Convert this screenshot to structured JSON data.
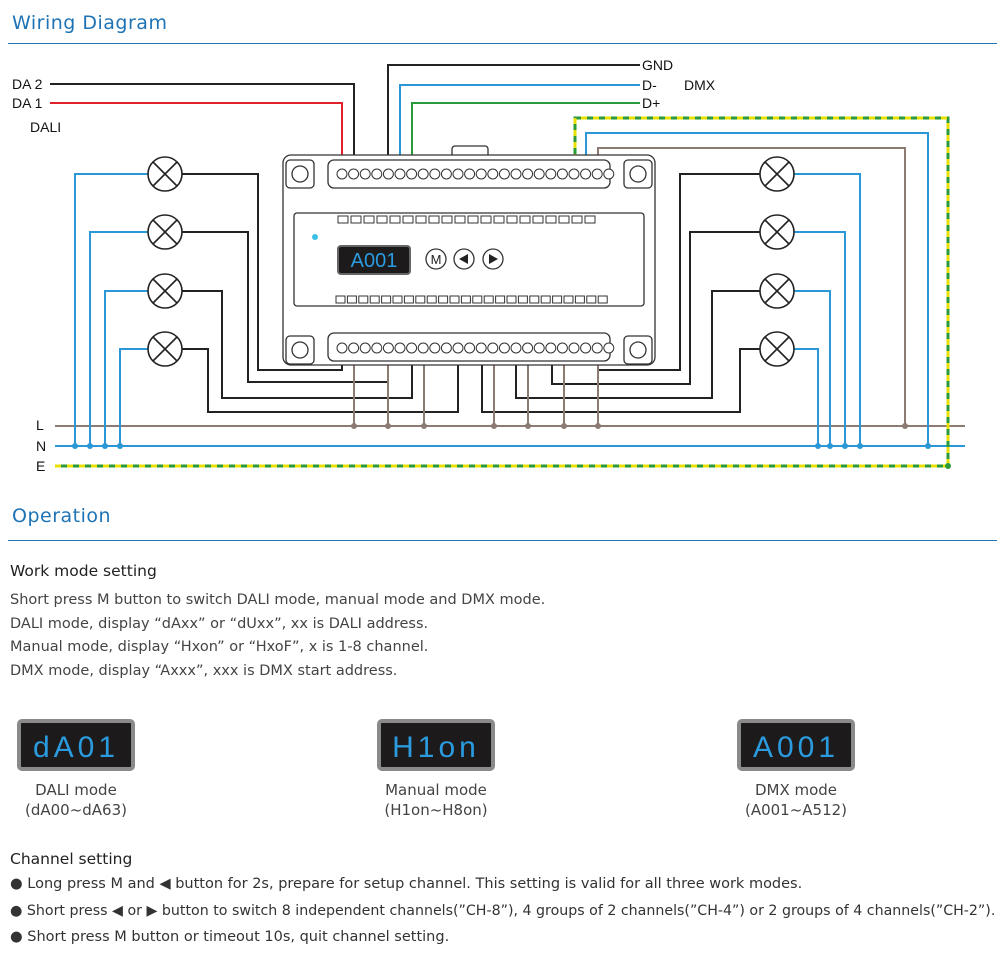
{
  "wiring": {
    "title": "Wiring Diagram",
    "labels": {
      "da2": "DA 2",
      "da1": "DA 1",
      "dali": "DALI",
      "gnd": "GND",
      "dminus": "D-",
      "dplus": "D+",
      "dmx": "DMX",
      "l": "L",
      "n": "N",
      "e": "E"
    },
    "device_display": "A001",
    "btn_m": "M",
    "colors": {
      "line_l": "#8c7b72",
      "line_n": "#2a98d6",
      "earth": "#d8d000",
      "earth2": "#2a9a3a",
      "dali_red": "#e0202a",
      "dplus": "#2a9a3a"
    }
  },
  "operation": {
    "title": "Operation",
    "work_mode": {
      "heading": "Work mode setting",
      "lines": [
        "Short press M button to switch DALI mode, manual mode and DMX mode.",
        "DALI mode, display “dAxx” or “dUxx”, xx is DALI address.",
        "Manual mode, display “Hxon” or “HxoF”, x is 1-8 channel.",
        "DMX mode, display “Axxx”, xxx is DMX start address."
      ]
    },
    "modes": [
      {
        "display": "dA01",
        "name": "DALI mode",
        "range": "(dA00~dA63)"
      },
      {
        "display": "H1on",
        "name": "Manual mode",
        "range": "(H1on~H8on)"
      },
      {
        "display": "A001",
        "name": "DMX mode",
        "range": "(A001~A512)"
      }
    ],
    "channel": {
      "heading": "Channel setting",
      "bullets": [
        "● Long press M and ◀ button for 2s, prepare for setup channel. This setting is valid for all three work modes.",
        "● Short press ◀ or ▶ button to switch 8 independent channels(”CH-8”), 4 groups of 2 channels(”CH-4”) or 2 groups of 4 channels(”CH-2”).",
        "● Short press M button or timeout 10s, quit channel setting."
      ]
    }
  }
}
